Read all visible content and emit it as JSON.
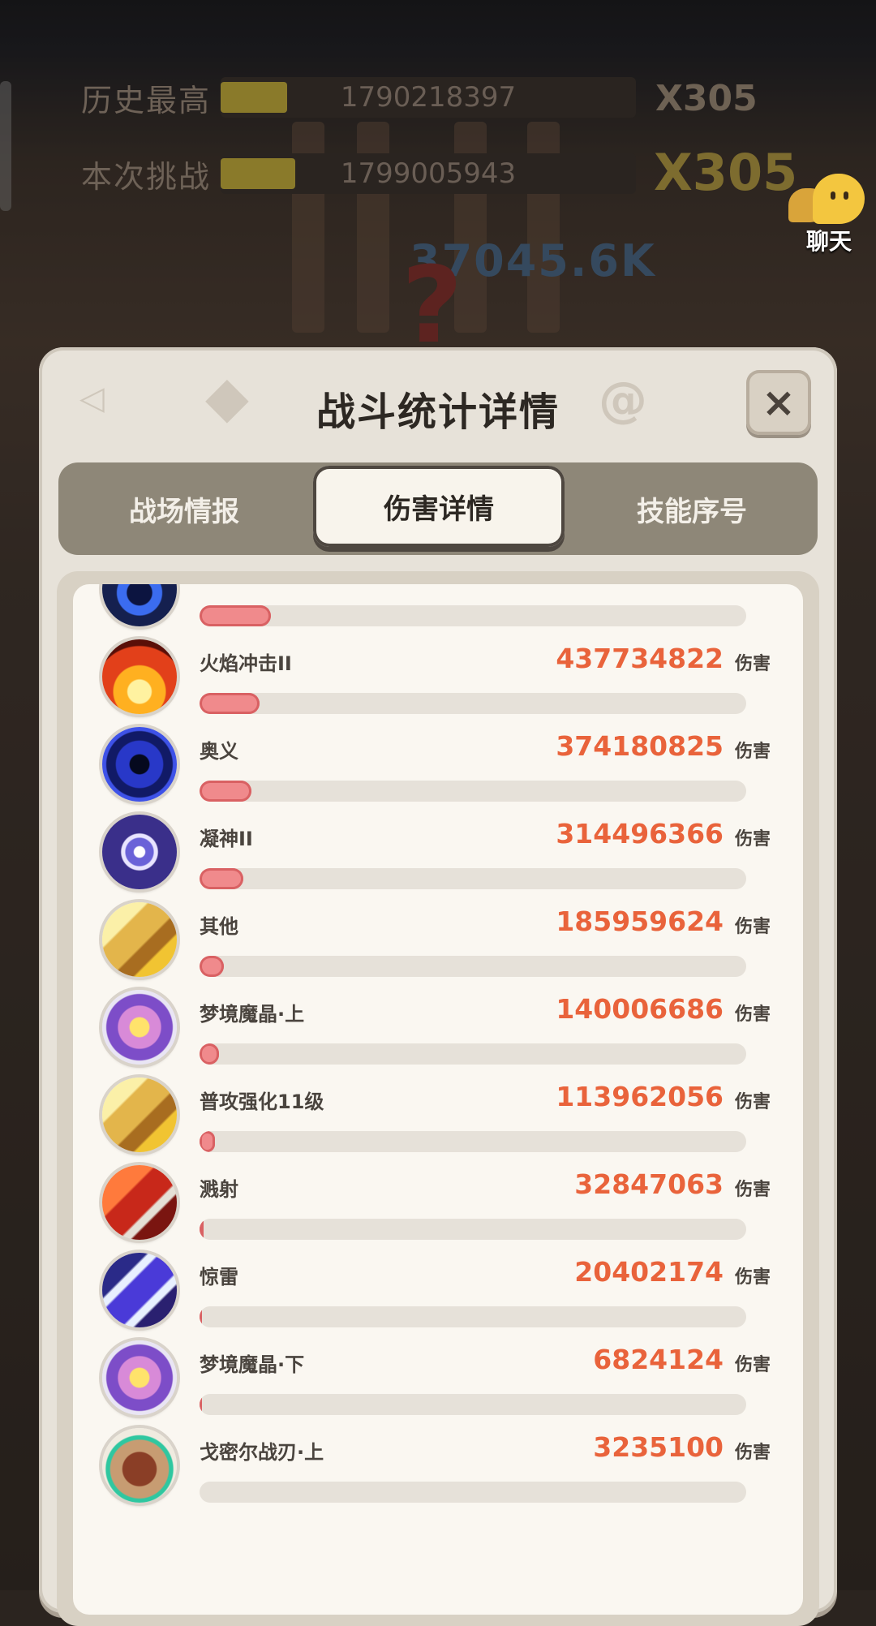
{
  "hud": {
    "best_label": "历史最高",
    "best_score": "1790218397",
    "best_multiplier": "X305",
    "current_label": "本次挑战",
    "current_score": "1799005943",
    "current_multiplier": "X305",
    "floating_damage": "37045.6K",
    "question_mark": "?"
  },
  "chat": {
    "label": "聊天"
  },
  "panel": {
    "title": "战斗统计详情",
    "close_symbol": "×",
    "tabs": [
      {
        "label": "战场情报",
        "active": false
      },
      {
        "label": "伤害详情",
        "active": true
      },
      {
        "label": "技能序号",
        "active": false
      }
    ]
  },
  "damage_unit": "伤害",
  "skills": [
    {
      "name": "",
      "value": "",
      "fraction": 0.13,
      "icon": "void-orb-icon"
    },
    {
      "name": "火焰冲击II",
      "value": "437734822",
      "fraction": 0.11,
      "icon": "flame-burst-icon"
    },
    {
      "name": "奥义",
      "value": "374180825",
      "fraction": 0.095,
      "icon": "vortex-icon"
    },
    {
      "name": "凝神II",
      "value": "314496366",
      "fraction": 0.08,
      "icon": "eye-icon"
    },
    {
      "name": "其他",
      "value": "185959624",
      "fraction": 0.045,
      "icon": "hammer-icon"
    },
    {
      "name": "梦境魔晶·上",
      "value": "140006686",
      "fraction": 0.035,
      "icon": "dream-crystal-icon"
    },
    {
      "name": "普攻强化11级",
      "value": "113962056",
      "fraction": 0.028,
      "icon": "hammer-icon"
    },
    {
      "name": "溅射",
      "value": "32847063",
      "fraction": 0.008,
      "icon": "spear-icon"
    },
    {
      "name": "惊雷",
      "value": "20402174",
      "fraction": 0.005,
      "icon": "lightning-icon"
    },
    {
      "name": "梦境魔晶·下",
      "value": "6824124",
      "fraction": 0.002,
      "icon": "dream-crystal-icon"
    },
    {
      "name": "戈密尔战刃·上",
      "value": "3235100",
      "fraction": 0.0,
      "icon": "war-blade-icon"
    }
  ]
}
